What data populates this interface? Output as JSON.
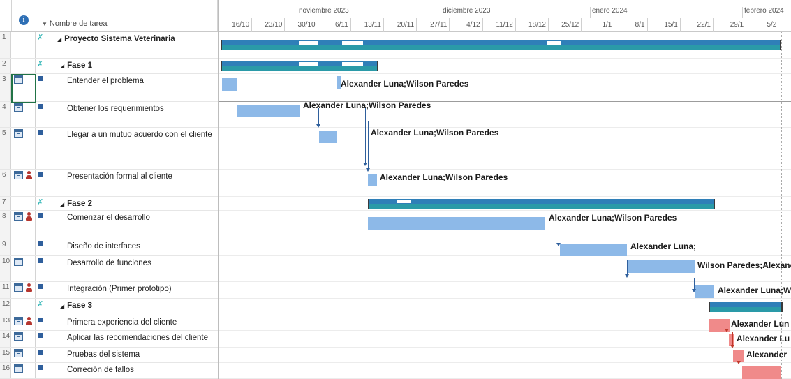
{
  "grid": {
    "header": {
      "info_icon": "info-icon",
      "name_column": "Nombre de tarea"
    },
    "rows": [
      {
        "id": "1",
        "name": "Proyecto Sistema Veterinaria",
        "summary": true,
        "indent": 0,
        "indicators": [],
        "mode": "manual"
      },
      {
        "id": "2",
        "name": "Fase 1",
        "summary": true,
        "indent": 1,
        "indicators": [],
        "mode": "manual"
      },
      {
        "id": "3",
        "name": "Entender el problema",
        "summary": false,
        "indent": 2,
        "indicators": [
          "calendar-icon"
        ],
        "mode": "auto"
      },
      {
        "id": "4",
        "name": "Obtener los requerimientos",
        "summary": false,
        "indent": 2,
        "indicators": [
          "calendar-icon"
        ],
        "mode": "auto"
      },
      {
        "id": "5",
        "name": "Llegar a un mutuo acuerdo con el cliente",
        "summary": false,
        "indent": 2,
        "indicators": [
          "calendar-icon"
        ],
        "mode": "auto"
      },
      {
        "id": "6",
        "name": "Presentación formal al cliente",
        "summary": false,
        "indent": 2,
        "indicators": [
          "calendar-icon",
          "person-icon"
        ],
        "mode": "auto"
      },
      {
        "id": "7",
        "name": "Fase 2",
        "summary": true,
        "indent": 1,
        "indicators": [],
        "mode": "manual"
      },
      {
        "id": "8",
        "name": "Comenzar el desarrollo",
        "summary": false,
        "indent": 2,
        "indicators": [
          "calendar-icon",
          "person-icon"
        ],
        "mode": "auto"
      },
      {
        "id": "9",
        "name": "Diseño de interfaces",
        "summary": false,
        "indent": 2,
        "indicators": [],
        "mode": "auto"
      },
      {
        "id": "10",
        "name": "Desarrollo de funciones",
        "summary": false,
        "indent": 2,
        "indicators": [
          "calendar-icon"
        ],
        "mode": "auto"
      },
      {
        "id": "11",
        "name": "Integración (Primer prototipo)",
        "summary": false,
        "indent": 2,
        "indicators": [
          "calendar-icon",
          "person-icon"
        ],
        "mode": "auto"
      },
      {
        "id": "12",
        "name": "Fase 3",
        "summary": true,
        "indent": 1,
        "indicators": [],
        "mode": "manual"
      },
      {
        "id": "13",
        "name": "Primera experiencia del cliente",
        "summary": false,
        "indent": 2,
        "indicators": [
          "calendar-icon",
          "person-icon"
        ],
        "mode": "auto"
      },
      {
        "id": "14",
        "name": "Aplicar las recomendaciones del cliente",
        "summary": false,
        "indent": 2,
        "indicators": [
          "calendar-icon"
        ],
        "mode": "auto"
      },
      {
        "id": "15",
        "name": "Pruebas del sistema",
        "summary": false,
        "indent": 2,
        "indicators": [
          "calendar-icon"
        ],
        "mode": "auto"
      },
      {
        "id": "16",
        "name": "Correción de fallos",
        "summary": false,
        "indent": 2,
        "indicators": [
          "calendar-icon"
        ],
        "mode": "auto"
      }
    ]
  },
  "timescale": {
    "months": [
      "noviembre 2023",
      "diciembre 2023",
      "enero 2024",
      "febrero 2024"
    ],
    "weeks": [
      "16/10",
      "23/10",
      "30/10",
      "6/11",
      "13/11",
      "20/11",
      "27/11",
      "4/12",
      "11/12",
      "18/12",
      "25/12",
      "1/1",
      "8/1",
      "15/1",
      "22/1",
      "29/1",
      "5/2"
    ]
  },
  "gantt": {
    "bars": [
      {
        "row": 3,
        "label": "Alexander Luna;Wilson Paredes"
      },
      {
        "row": 4,
        "label": "Alexander Luna;Wilson Paredes"
      },
      {
        "row": 5,
        "label": "Alexander Luna;Wilson Paredes"
      },
      {
        "row": 6,
        "label": "Alexander Luna;Wilson Paredes"
      },
      {
        "row": 8,
        "label": "Alexander Luna;Wilson Paredes"
      },
      {
        "row": 9,
        "label": "Alexander Luna;"
      },
      {
        "row": 10,
        "label": "Wilson Paredes;Alexand"
      },
      {
        "row": 11,
        "label": "Alexander Luna;W"
      },
      {
        "row": 13,
        "label": "Alexander Lun"
      },
      {
        "row": 14,
        "label": "Alexander Lu"
      },
      {
        "row": 15,
        "label": "Alexander"
      },
      {
        "row": 16,
        "label": ""
      }
    ]
  },
  "colors": {
    "task_bar": "#8db9e8",
    "critical_bar": "#f08a8a",
    "summary_bar": "#2a9aa8",
    "today_line": "#5aa05a",
    "link": "#2f5f9c"
  }
}
